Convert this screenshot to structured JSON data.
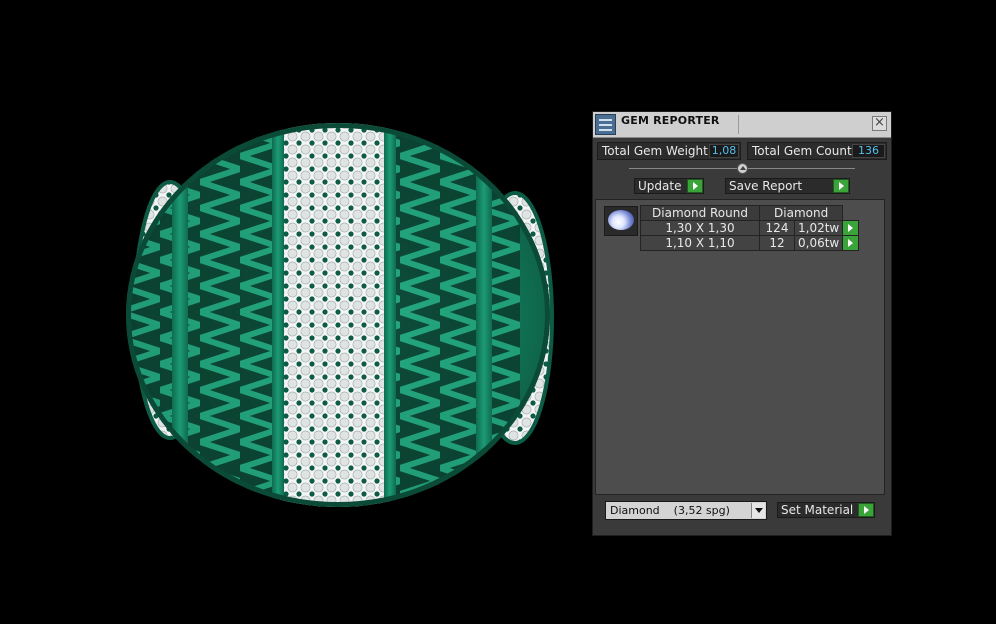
{
  "panel": {
    "title": "GEM REPORTER",
    "close_icon": "close-icon",
    "total_weight_label": "Total Gem Weight",
    "total_weight_value": "1,08",
    "total_count_label": "Total Gem Count",
    "total_count_value": "136",
    "update_label": "Update",
    "save_report_label": "Save Report",
    "table": {
      "header": [
        "Diamond Round",
        "Diamond"
      ],
      "rows": [
        {
          "size": "1,30 X 1,30",
          "count": "124",
          "weight": "1,02tw"
        },
        {
          "size": "1,10 X 1,10",
          "count": "12",
          "weight": "0,06tw"
        }
      ]
    },
    "material_select": "Diamond    (3,52 spg)",
    "set_material_label": "Set Material",
    "colors": {
      "accent_green": "#3aa33a",
      "value_blue": "#55c0f0",
      "model_green": "#1f8a6a"
    }
  }
}
